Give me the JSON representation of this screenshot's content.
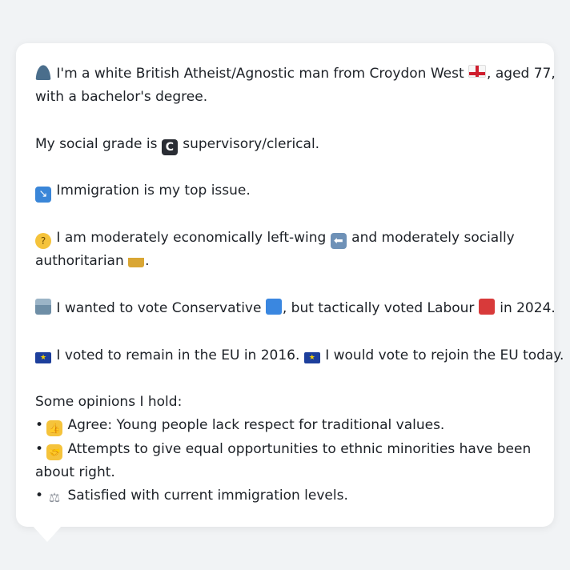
{
  "profile": {
    "p1_a": "I'm a white British Atheist/Agnostic man from Croydon West",
    "p1_b": ", aged 77,",
    "p1_c": "with a bachelor's degree.",
    "p2_a": "My social grade is",
    "p2_b": "supervisory/clerical.",
    "p3": "Immigration is my top issue.",
    "p4_a": "I am moderately economically left-wing",
    "p4_b": "and moderately socially",
    "p4_c": "authoritarian",
    "p4_d": ".",
    "p5_a": "I wanted to vote Conservative",
    "p5_b": ", but tactically voted Labour",
    "p5_c": "in 2024.",
    "p6_a": "I voted to remain in the EU in 2016.",
    "p6_b": "I would vote to rejoin the EU today.",
    "opinions_heading": "Some opinions I hold:",
    "bullet": "•",
    "op1": "Agree: Young people lack respect for traditional values.",
    "op2_a": "Attempts to give equal opportunities to ethnic minorities have been",
    "op2_b": "about right.",
    "op3": "Satisfied with current immigration levels."
  },
  "glyphs": {
    "grade": "C",
    "exit": "↘",
    "think": "?",
    "left": "⬅",
    "eu": "★",
    "thumb": "👍",
    "hand": "🤝",
    "scale": "⚖"
  },
  "icons": {
    "person": "person-silhouette-icon",
    "england_flag": "england-flag-icon",
    "grade_c": "letter-c-icon",
    "exit": "exit-arrow-icon",
    "thinking": "thinking-face-icon",
    "left_arrow": "left-arrow-icon",
    "lock": "lock-icon",
    "ballot": "ballot-box-icon",
    "blue_square": "blue-square-icon",
    "red_square": "red-square-icon",
    "eu_flag": "eu-flag-icon",
    "thumbs_up": "thumbs-up-icon",
    "handshake": "handshake-icon",
    "scales": "balance-scale-icon"
  },
  "colors": {
    "background": "#f1f3f5",
    "card": "#ffffff",
    "text": "#1d2127",
    "conservative": "#3a87e0",
    "labour": "#d83a3a"
  }
}
